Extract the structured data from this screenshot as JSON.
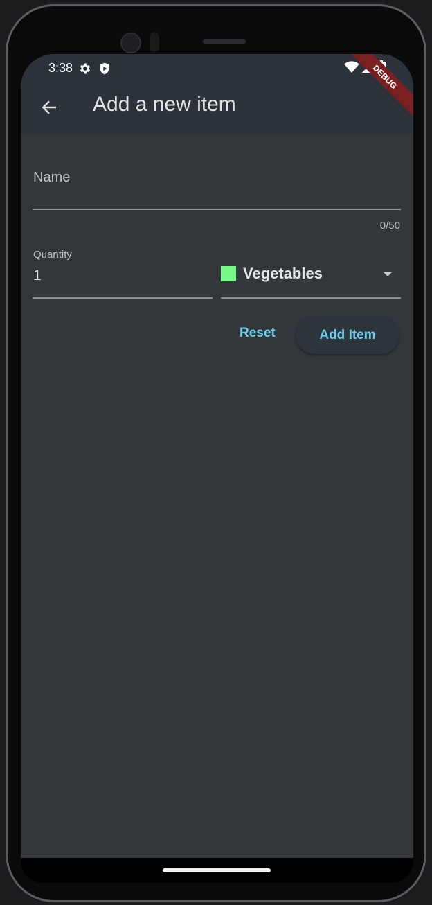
{
  "status_bar": {
    "time": "3:38",
    "icons": [
      "gear-icon",
      "shield-play-icon",
      "wifi-icon",
      "signal-icon",
      "battery-icon"
    ]
  },
  "debug_banner": "DEBUG",
  "app_bar": {
    "title": "Add a new item",
    "back_icon": "arrow-back-icon"
  },
  "form": {
    "name": {
      "label": "Name",
      "value": "",
      "counter": "0/50"
    },
    "quantity": {
      "label": "Quantity",
      "value": "1"
    },
    "category": {
      "selected": "Vegetables",
      "color": "#77fc8b"
    },
    "reset_label": "Reset",
    "add_label": "Add Item"
  },
  "colors": {
    "accent": "#6dcdec",
    "background": "#33373b",
    "app_bar": "#2c323a",
    "debug": "#7a2020"
  }
}
